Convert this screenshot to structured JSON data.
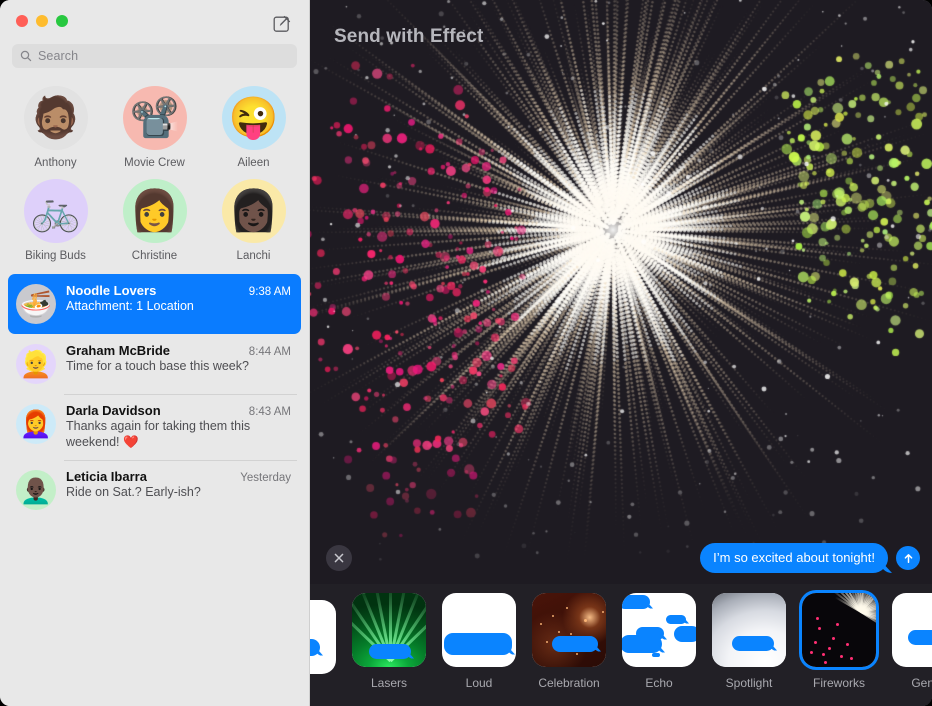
{
  "window": {
    "traffic_lights": [
      "close",
      "minimize",
      "zoom"
    ],
    "colors": {
      "accent_blue": "#0A7CFF",
      "bubble_blue": "#0A84FF",
      "sidebar_bg": "#E8E8E8",
      "main_bg": "#1E1B22",
      "strip_bg": "#222026",
      "selected_border": "#0A84FF"
    }
  },
  "sidebar": {
    "compose_icon": "compose-pencil-square-icon",
    "search": {
      "icon": "search-icon",
      "placeholder": "Search",
      "value": ""
    },
    "pinned": [
      {
        "name": "Anthony",
        "avatar_glyph": "🧔🏽",
        "avatar_bg": "#E2E2E2",
        "icon_name": "avatar-memoji-anthony"
      },
      {
        "name": "Movie Crew",
        "avatar_glyph": "📽️",
        "avatar_bg": "#F7B9B0",
        "icon_name": "avatar-group-movie-crew"
      },
      {
        "name": "Aileen",
        "avatar_glyph": "😜",
        "avatar_bg": "#BDE3F5",
        "icon_name": "avatar-memoji-aileen"
      },
      {
        "name": "Biking Buds",
        "avatar_glyph": "🚲",
        "avatar_bg": "#DED0FA",
        "icon_name": "avatar-group-biking-buds"
      },
      {
        "name": "Christine",
        "avatar_glyph": "👩",
        "avatar_bg": "#BFEFC9",
        "icon_name": "avatar-memoji-christine"
      },
      {
        "name": "Lanchi",
        "avatar_glyph": "👩🏿",
        "avatar_bg": "#FAE9A8",
        "icon_name": "avatar-memoji-lanchi"
      }
    ],
    "conversations": [
      {
        "title": "Noodle Lovers",
        "time": "9:38 AM",
        "snippet": "Attachment: 1 Location",
        "avatar_glyph": "🍜",
        "avatar_bg": "#C9C9CE",
        "icon_name": "avatar-group-noodle-lovers",
        "selected": true
      },
      {
        "title": "Graham McBride",
        "time": "8:44 AM",
        "snippet": "Time for a touch base this week?",
        "avatar_glyph": "👱",
        "avatar_bg": "#E4D6FB",
        "icon_name": "avatar-memoji-graham-mcbride",
        "selected": false
      },
      {
        "title": "Darla Davidson",
        "time": "8:43 AM",
        "snippet": "Thanks again for taking them this weekend! ❤️",
        "avatar_glyph": "👩‍🦰",
        "avatar_bg": "#CDEAF8",
        "icon_name": "avatar-memoji-darla-davidson",
        "selected": false
      },
      {
        "title": "Leticia Ibarra",
        "time": "Yesterday",
        "snippet": "Ride on Sat.? Early-ish?",
        "avatar_glyph": "👨🏿‍🦲",
        "avatar_bg": "#C3EFC8",
        "icon_name": "avatar-memoji-leticia-ibarra",
        "selected": false
      }
    ]
  },
  "main": {
    "title": "Send with Effect",
    "preview_effect": "Fireworks",
    "close_button": {
      "icon": "close-x-icon",
      "label": ""
    },
    "message": {
      "text": "I’m so excited about tonight!",
      "outgoing": true
    },
    "send_button": {
      "icon": "send-arrow-up-icon",
      "label": ""
    },
    "effects": [
      {
        "name": "",
        "icon_name": "effect-thumb-partial",
        "selected": false,
        "thumb": "plain"
      },
      {
        "name": "Lasers",
        "icon_name": "effect-thumb-lasers",
        "selected": false,
        "thumb": "lasers"
      },
      {
        "name": "Loud",
        "icon_name": "effect-thumb-loud",
        "selected": false,
        "thumb": "loud"
      },
      {
        "name": "Celebration",
        "icon_name": "effect-thumb-celebration",
        "selected": false,
        "thumb": "celebration"
      },
      {
        "name": "Echo",
        "icon_name": "effect-thumb-echo",
        "selected": false,
        "thumb": "echo"
      },
      {
        "name": "Spotlight",
        "icon_name": "effect-thumb-spotlight",
        "selected": false,
        "thumb": "spotlight"
      },
      {
        "name": "Fireworks",
        "icon_name": "effect-thumb-fireworks",
        "selected": true,
        "thumb": "fireworks"
      },
      {
        "name": "Gentle",
        "icon_name": "effect-thumb-gentle",
        "selected": false,
        "thumb": "gentle"
      }
    ]
  }
}
